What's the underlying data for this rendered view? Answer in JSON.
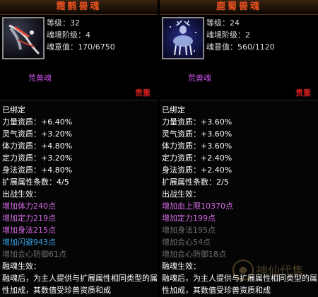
{
  "left": {
    "title": "霜鹤兽魂",
    "level": "等级：32",
    "stage": "魂境阶级：4",
    "value": "魂意值：170/6750",
    "soul_name": "荒兽魂",
    "quality": "贵重",
    "lines": [
      {
        "text": "已绑定",
        "cls": "white"
      },
      {
        "text": "力量资质：+6.40%",
        "cls": "white"
      },
      {
        "text": "灵气资质：+3.20%",
        "cls": "white"
      },
      {
        "text": "体力资质：+4.80%",
        "cls": "white"
      },
      {
        "text": "定力资质：+3.20%",
        "cls": "white"
      },
      {
        "text": "身法资质：+4.80%",
        "cls": "white"
      },
      {
        "text": "扩展属性条数：4/5",
        "cls": "white"
      },
      {
        "text": "出战生效：",
        "cls": "white"
      },
      {
        "text": "增加体力240点",
        "cls": "pink"
      },
      {
        "text": "增加定力219点",
        "cls": "pink"
      },
      {
        "text": "增加身法215点",
        "cls": "pink"
      },
      {
        "text": "增加闪避943点",
        "cls": "blue"
      },
      {
        "text": "增加会心防御61点",
        "cls": "grey"
      },
      {
        "text": "融魂生效：",
        "cls": "white"
      }
    ],
    "desc": "融魂后，为主人提供与扩展属性相同类型的属性加成，其数值受珍兽资质和成"
  },
  "right": {
    "title": "鹿蜀兽魂",
    "level": "等级：24",
    "stage": "魂境阶级：2",
    "value": "魂意值：560/1120",
    "soul_name": "荒兽魂",
    "quality": "贵重",
    "lines": [
      {
        "text": "已绑定",
        "cls": "white"
      },
      {
        "text": "力量资质：+3.60%",
        "cls": "white"
      },
      {
        "text": "灵气资质：+3.60%",
        "cls": "white"
      },
      {
        "text": "体力资质：+3.60%",
        "cls": "white"
      },
      {
        "text": "定力资质：+2.40%",
        "cls": "white"
      },
      {
        "text": "身法资质：+2.40%",
        "cls": "white"
      },
      {
        "text": "扩展属性条数：2/5",
        "cls": "white"
      },
      {
        "text": "出战生效：",
        "cls": "white"
      },
      {
        "text": "增加血上限10370点",
        "cls": "pink"
      },
      {
        "text": "增加定力199点",
        "cls": "pink"
      },
      {
        "text": "增加身法195点",
        "cls": "grey"
      },
      {
        "text": "增加会心54点",
        "cls": "grey"
      },
      {
        "text": "增加会心防御18点",
        "cls": "grey"
      },
      {
        "text": "融魂生效：",
        "cls": "white"
      }
    ],
    "desc": "融魂后，为主人提供与扩展属性相同类型的属性加成，其数值受珍兽资质和成"
  },
  "watermark": "神仙代售",
  "colors": {
    "title": "#e8501f",
    "quality": "#d21e1e",
    "pink": "#d66ae8",
    "blue": "#3aa5e8",
    "grey": "#6e6e6e"
  }
}
